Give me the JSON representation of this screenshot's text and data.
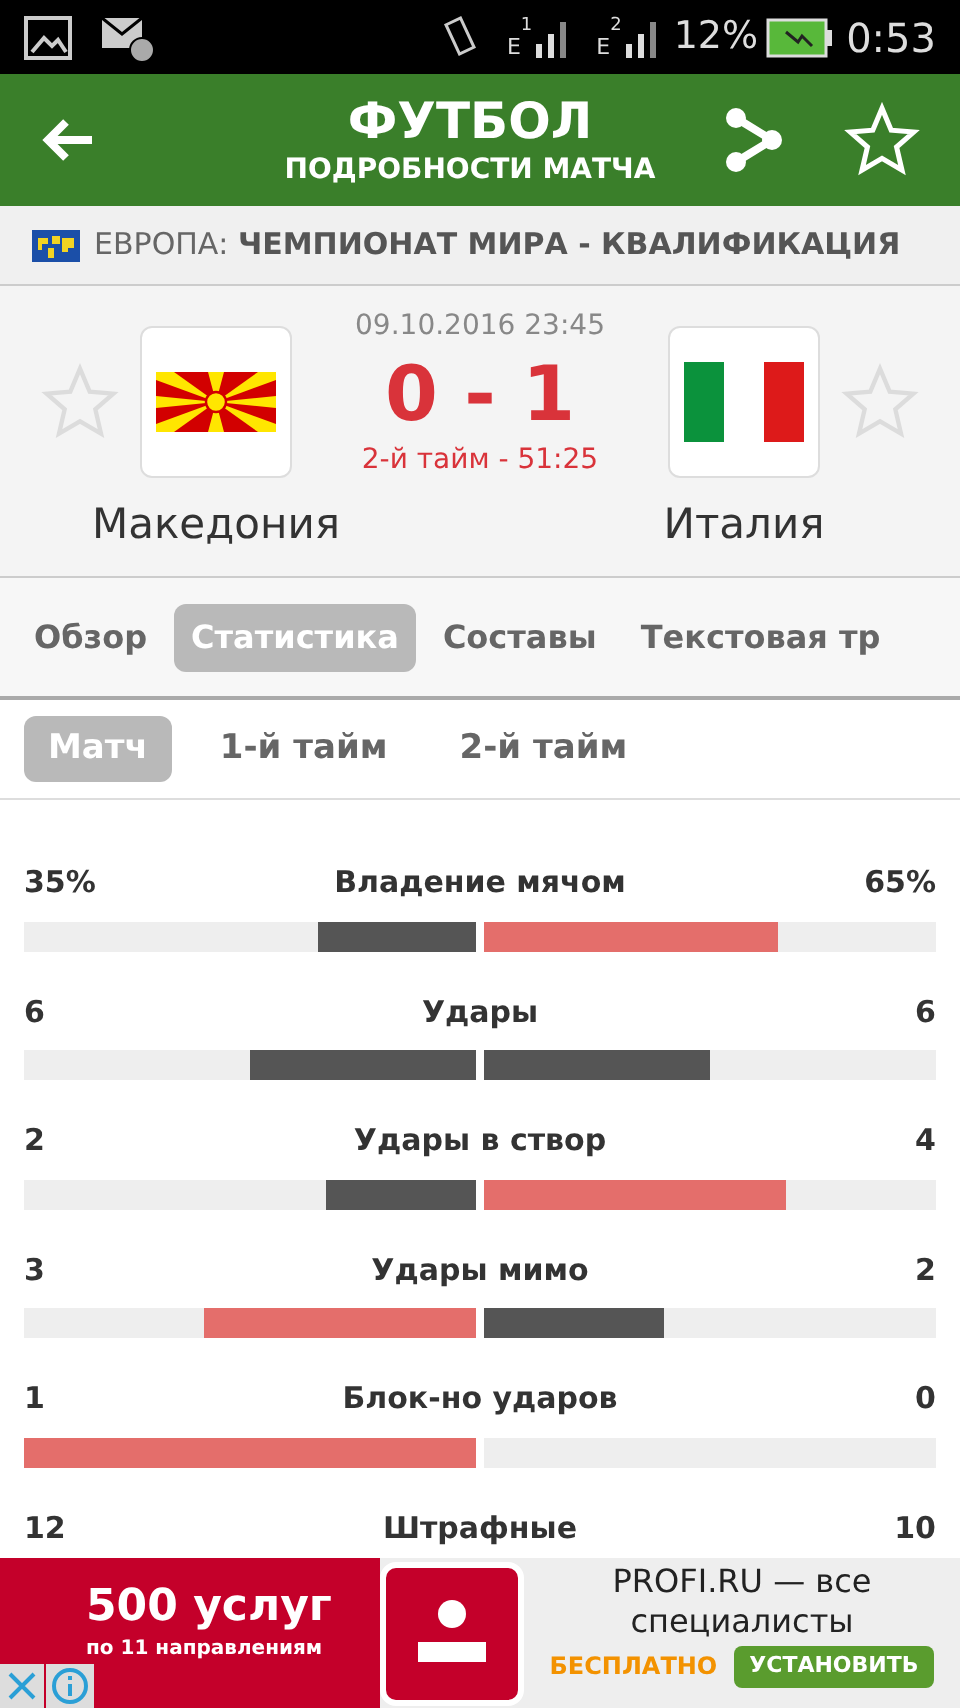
{
  "status_bar": {
    "sim1": "1",
    "sim1_network": "E",
    "sim2": "2",
    "sim2_network": "E",
    "battery": "12%",
    "time": "0:53"
  },
  "header": {
    "title": "ФУТБОЛ",
    "subtitle": "ПОДРОБНОСТИ МАТЧА"
  },
  "league": {
    "region": "ЕВРОПА:",
    "name": "ЧЕМПИОНАТ МИРА - КВАЛИФИКАЦИЯ"
  },
  "match": {
    "datetime": "09.10.2016 23:45",
    "score": "0 - 1",
    "status": "2-й тайм - 51:25",
    "home": {
      "name": "Македония",
      "favorite": false
    },
    "away": {
      "name": "Италия",
      "favorite": false
    }
  },
  "tabs": [
    {
      "label": "Обзор",
      "selected": false
    },
    {
      "label": "Статистика",
      "selected": true
    },
    {
      "label": "Составы",
      "selected": false
    },
    {
      "label": "Текстовая тр",
      "selected": false
    }
  ],
  "period_tabs": [
    {
      "label": "Матч",
      "selected": true
    },
    {
      "label": "1-й тайм",
      "selected": false
    },
    {
      "label": "2-й тайм",
      "selected": false
    }
  ],
  "stats": [
    {
      "label": "Владение мячом",
      "home": {
        "value": "35%",
        "level": 0.35,
        "color": "#555555"
      },
      "away": {
        "value": "65%",
        "level": 0.65,
        "color": "#e46e6b"
      }
    },
    {
      "label": "Удары",
      "home": {
        "value": "6",
        "level": 0.5,
        "color": "#555555"
      },
      "away": {
        "value": "6",
        "level": 0.5,
        "color": "#555555"
      }
    },
    {
      "label": "Удары в створ",
      "home": {
        "value": "2",
        "level": 0.33,
        "color": "#555555"
      },
      "away": {
        "value": "4",
        "level": 0.67,
        "color": "#e46e6b"
      }
    },
    {
      "label": "Удары мимо",
      "home": {
        "value": "3",
        "level": 0.6,
        "color": "#e46e6b"
      },
      "away": {
        "value": "2",
        "level": 0.4,
        "color": "#555555"
      }
    },
    {
      "label": "Блок-но ударов",
      "home": {
        "value": "1",
        "level": 1,
        "color": "#e46e6b"
      },
      "away": {
        "value": "0"
      }
    },
    {
      "label": "Штрафные",
      "home": {
        "value": "12"
      },
      "away": {
        "value": "10"
      }
    }
  ],
  "ad": {
    "headline": "500 услуг",
    "subline": "по 11 направлениям",
    "title": "PROFI.RU — все специалисты",
    "price": "БЕСПЛАТНО",
    "button": "УСТАНОВИТЬ"
  }
}
